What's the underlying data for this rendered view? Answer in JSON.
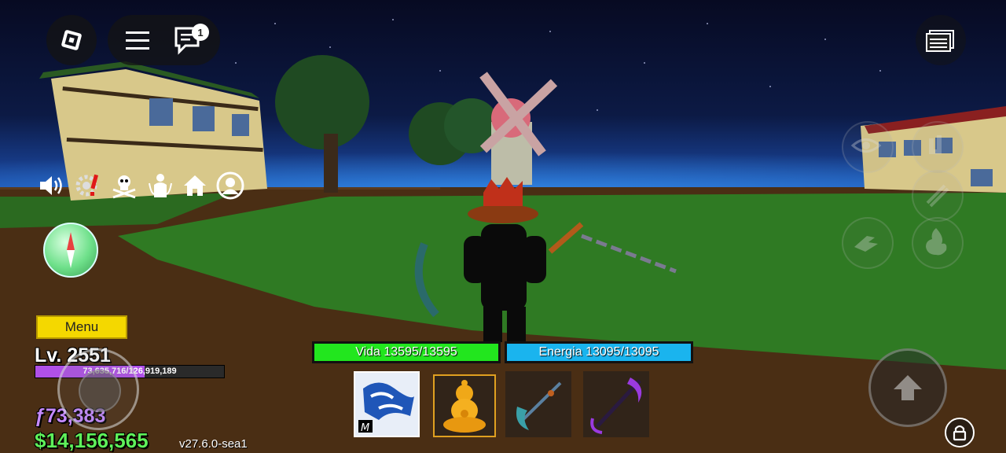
{
  "top_bar": {
    "notification_count": "1"
  },
  "menu": {
    "label": "Menu"
  },
  "stats": {
    "level": "Lv. 2551",
    "xp_text": "73,635,716/126,919,189",
    "xp_fraction": 0.58,
    "fragments": "ƒ73,383",
    "money": "$14,156,565",
    "version": "v27.6.0-sea1"
  },
  "health_bar": {
    "label": "Vida 13595/13595",
    "fraction": 1.0,
    "color": "#22e61e"
  },
  "energy_bar": {
    "label": "Energia 13095/13095",
    "fraction": 1.0,
    "color": "#1ab4ee"
  },
  "hotbar": {
    "slots": [
      {
        "name": "dough-fruit-slot",
        "selected": false
      },
      {
        "name": "buddha-fruit-slot",
        "selected": true
      },
      {
        "name": "scythe-slot",
        "selected": false
      },
      {
        "name": "purple-scythe-slot",
        "selected": false
      }
    ]
  },
  "colors": {
    "menu_yellow": "#f4d800",
    "xp_purple": "#b050e8",
    "money_green": "#5ff05a",
    "fragments_purple": "#c58aff",
    "sky": "#0b1030",
    "grass": "#2f7a23",
    "dirt": "#4a2e14"
  }
}
